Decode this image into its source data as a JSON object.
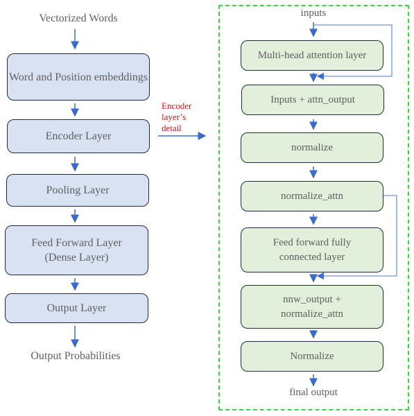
{
  "left": {
    "input": "Vectorized Words",
    "boxes": [
      "Word and Position embeddings",
      "Encoder Layer",
      "Pooling Layer",
      "Feed Forward Layer (Dense Layer)",
      "Output Layer"
    ],
    "output": "Output Probabilities"
  },
  "link_label": "Encoder layer’s detail",
  "right": {
    "input": "inputs",
    "boxes": [
      "Multi-head attention layer",
      "Inputs + attn_output",
      "normalize",
      "normalize_attn",
      "Feed forward fully connected layer",
      "nnw_output + normalize_attn",
      "Normalize"
    ],
    "output": "final output"
  },
  "colors": {
    "left_fill": "#d9e2f3",
    "right_fill": "#e2efda",
    "arrow": "#3a6bd1",
    "label": "#e01010",
    "frame": "#33dd33"
  }
}
